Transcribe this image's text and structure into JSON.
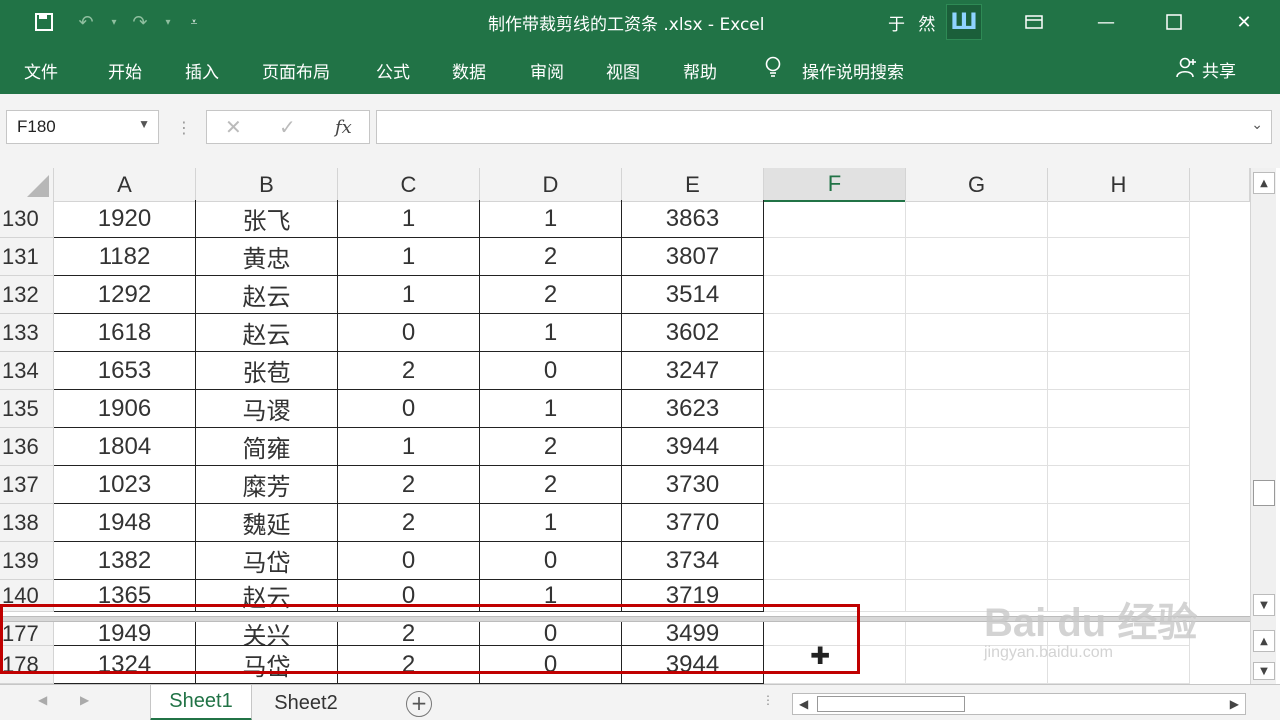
{
  "window": {
    "title": "制作带裁剪线的工资条 .xlsx  -  Excel",
    "user": "于 然",
    "avatar_text": "Ш"
  },
  "quick_access": [
    "save-icon",
    "undo-icon",
    "redo-icon",
    "customize-icon"
  ],
  "ribbon": {
    "tabs": [
      "文件",
      "开始",
      "插入",
      "页面布局",
      "公式",
      "数据",
      "审阅",
      "视图",
      "帮助",
      "操作说明搜索"
    ],
    "share_label": "共享"
  },
  "formula_bar": {
    "name_box": "F180",
    "fx_label": "fx",
    "formula": ""
  },
  "columns": [
    "A",
    "B",
    "C",
    "D",
    "E",
    "F",
    "G",
    "H"
  ],
  "selected_column": "F",
  "rows_top": [
    {
      "row": "130",
      "cells": [
        "1920",
        "张飞",
        "1",
        "1",
        "3863"
      ]
    },
    {
      "row": "131",
      "cells": [
        "1182",
        "黄忠",
        "1",
        "2",
        "3807"
      ]
    },
    {
      "row": "132",
      "cells": [
        "1292",
        "赵云",
        "1",
        "2",
        "3514"
      ]
    },
    {
      "row": "133",
      "cells": [
        "1618",
        "赵云",
        "0",
        "1",
        "3602"
      ]
    },
    {
      "row": "134",
      "cells": [
        "1653",
        "张苞",
        "2",
        "0",
        "3247"
      ]
    },
    {
      "row": "135",
      "cells": [
        "1906",
        "马谡",
        "0",
        "1",
        "3623"
      ]
    },
    {
      "row": "136",
      "cells": [
        "1804",
        "简雍",
        "1",
        "2",
        "3944"
      ]
    },
    {
      "row": "137",
      "cells": [
        "1023",
        "糜芳",
        "2",
        "2",
        "3730"
      ]
    },
    {
      "row": "138",
      "cells": [
        "1948",
        "魏延",
        "2",
        "1",
        "3770"
      ]
    },
    {
      "row": "139",
      "cells": [
        "1382",
        "马岱",
        "0",
        "0",
        "3734"
      ]
    },
    {
      "row": "140",
      "cells": [
        "1365",
        "赵云",
        "0",
        "1",
        "3719"
      ]
    }
  ],
  "rows_bottom": [
    {
      "row": "177",
      "cells": [
        "1949",
        "关兴",
        "2",
        "0",
        "3499"
      ]
    },
    {
      "row": "178",
      "cells": [
        "1324",
        "马岱",
        "2",
        "0",
        "3944"
      ]
    }
  ],
  "sheets": [
    "Sheet1",
    "Sheet2"
  ],
  "active_sheet": "Sheet1",
  "watermark": {
    "main": "Bai du 经验",
    "sub": "jingyan.baidu.com"
  },
  "colors": {
    "accent": "#217346",
    "highlight": "#c00000"
  }
}
